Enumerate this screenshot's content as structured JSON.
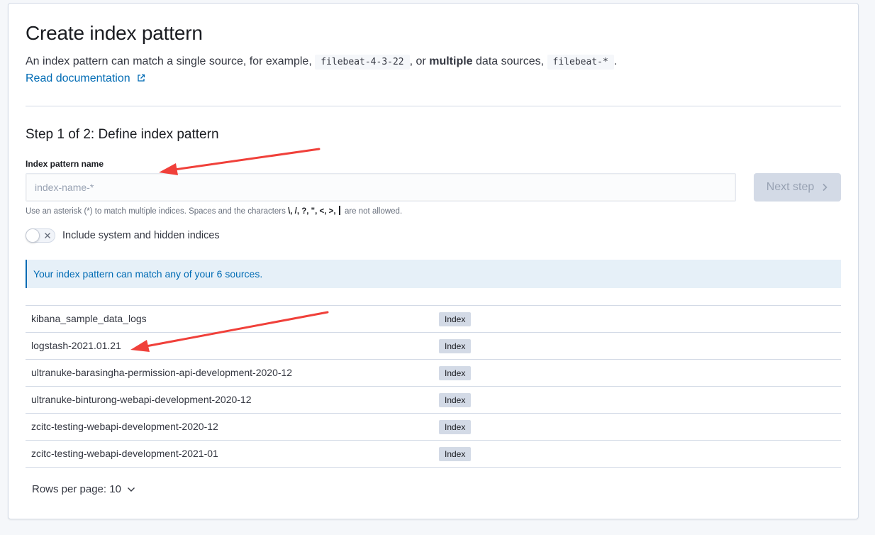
{
  "header": {
    "title": "Create index pattern",
    "description_prefix": "An index pattern can match a single source, for example,",
    "example_single": "filebeat-4-3-22",
    "description_middle": ", or",
    "description_bold": "multiple",
    "description_after_bold": "data sources,",
    "example_multiple": "filebeat-*",
    "description_end": ".",
    "doc_link": "Read documentation",
    "doc_link_icon": "external-link-icon"
  },
  "step": {
    "title": "Step 1 of 2: Define index pattern",
    "field_label": "Index pattern name",
    "input_value": "",
    "input_placeholder": "index-name-*",
    "next_button": "Next step",
    "help_prefix": "Use an asterisk (*) to match multiple indices. Spaces and the characters",
    "help_chars": "\\, /, ?, \", <, >,",
    "help_suffix": "are not allowed.",
    "toggle_label": "Include system and hidden indices",
    "toggle_on": false
  },
  "callout": {
    "text": "Your index pattern can match any of your 6 sources."
  },
  "indices": [
    {
      "name": "kibana_sample_data_logs",
      "type": "Index"
    },
    {
      "name": "logstash-2021.01.21",
      "type": "Index"
    },
    {
      "name": "ultranuke-barasingha-permission-api-development-2020-12",
      "type": "Index"
    },
    {
      "name": "ultranuke-binturong-webapi-development-2020-12",
      "type": "Index"
    },
    {
      "name": "zcitc-testing-webapi-development-2020-12",
      "type": "Index"
    },
    {
      "name": "zcitc-testing-webapi-development-2021-01",
      "type": "Index"
    }
  ],
  "pagination": {
    "rows_per_page": "Rows per page: 10"
  },
  "colors": {
    "accent": "#006bb4",
    "annotation_arrow": "#f0403a",
    "badge_bg": "#d3dae6",
    "callout_bg": "#e6f0f8"
  }
}
